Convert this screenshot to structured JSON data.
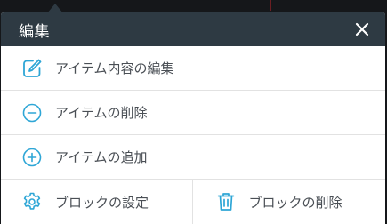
{
  "colors": {
    "header_bg": "#2e3a43",
    "accent": "#2ea6d6",
    "text": "#4a4f55"
  },
  "menu": {
    "title": "編集",
    "close_icon": "close-icon",
    "items": [
      {
        "label": "アイテム内容の編集",
        "icon": "edit-icon"
      },
      {
        "label": "アイテムの削除",
        "icon": "minus-circle-icon"
      },
      {
        "label": "アイテムの追加",
        "icon": "plus-circle-icon"
      }
    ],
    "block_actions": [
      {
        "label": "ブロックの設定",
        "icon": "gear-icon"
      },
      {
        "label": "ブロックの削除",
        "icon": "trash-icon"
      }
    ]
  }
}
